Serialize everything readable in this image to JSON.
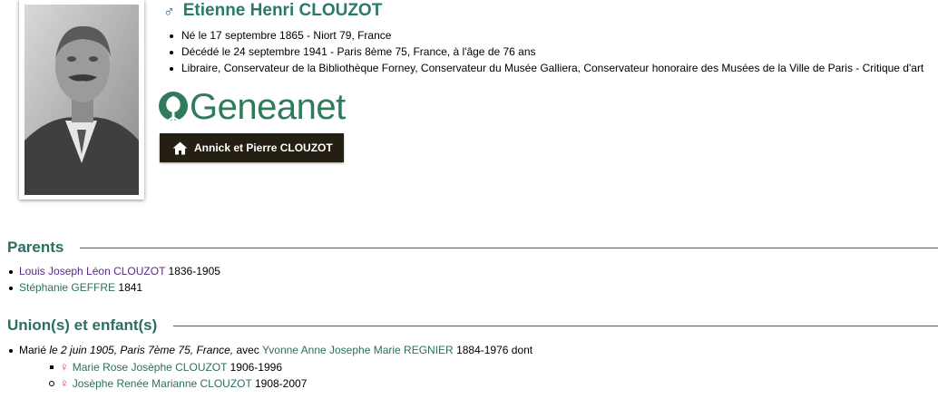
{
  "person": {
    "gender_symbol": "♂",
    "name": "Etienne Henri CLOUZOT",
    "facts": [
      "Né le 17 septembre 1865 - Niort 79, France",
      "Décédé le 24 septembre 1941 - Paris 8ème 75, France, à l'âge de 76 ans",
      "Libraire, Conservateur de la Bibliothèque Forney, Conservateur du Musée Galliera, Conservateur honoraire des Musées de la Ville de Paris - Critique d'art"
    ]
  },
  "logo": {
    "text": "Geneanet",
    "color": "#2f7b5b"
  },
  "tree_button": {
    "label": "Annick et Pierre CLOUZOT",
    "icon": "home-icon"
  },
  "parents": {
    "title": "Parents",
    "items": [
      {
        "name": "Louis Joseph Léon CLOUZOT",
        "years": " 1836-1905"
      },
      {
        "name": "Stéphanie GEFFRE",
        "years": " 1841"
      }
    ]
  },
  "unions": {
    "title": "Union(s) et enfant(s)",
    "marriage": {
      "prefix": "Marié ",
      "details": "le 2 juin 1905, Paris 7ème 75, France,",
      "avec": " avec ",
      "spouse": "Yvonne Anne Josephe Marie REGNIER",
      "years": " 1884-1976 dont"
    },
    "children": [
      {
        "gender_symbol": "♀",
        "name": "Marie Rose Josèphe CLOUZOT",
        "years": " 1906-1996"
      },
      {
        "gender_symbol": "♀",
        "name": "Josèphe Renée Marianne CLOUZOT",
        "years": " 1908-2007"
      }
    ]
  },
  "colors": {
    "section": "#2a6f63",
    "link": "#2a6f63",
    "visited_link": "#5a2a86",
    "female": "#d62f8e",
    "male": "#1f5a86"
  }
}
